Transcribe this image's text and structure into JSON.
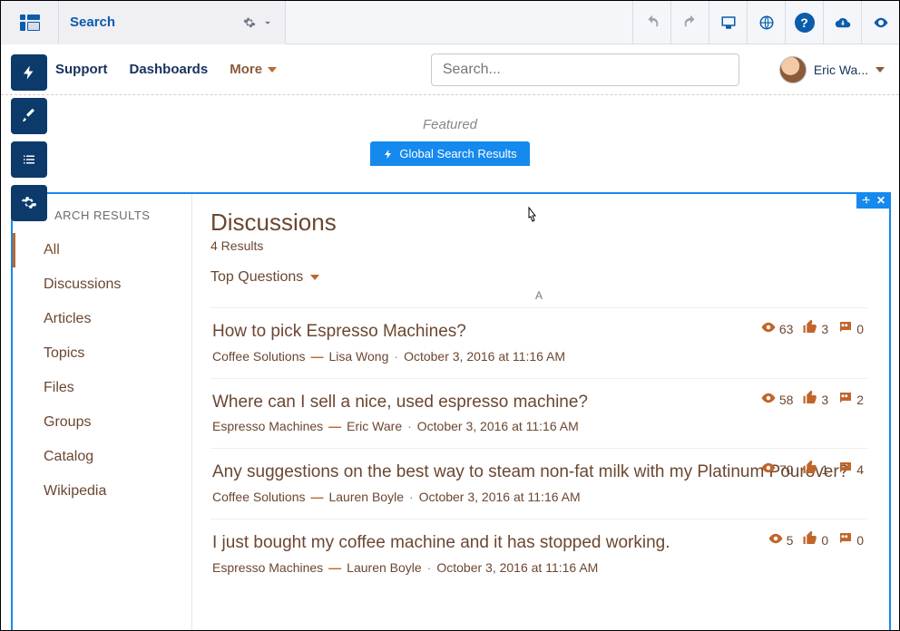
{
  "topbar": {
    "page_select": "Search"
  },
  "nav": {
    "items": [
      "Support",
      "Dashboards"
    ],
    "more": "More",
    "search_placeholder": "Search...",
    "user_name": "Eric Wa..."
  },
  "featured_label": "Featured",
  "pill_label": "Global Search Results",
  "sidebar": {
    "heading": "ARCH RESULTS",
    "items": [
      "All",
      "Discussions",
      "Articles",
      "Topics",
      "Files",
      "Groups",
      "Catalog",
      "Wikipedia"
    ],
    "active_index": 0
  },
  "main": {
    "title": "Discussions",
    "count_text": "4 Results",
    "sort_label": "Top Questions",
    "letter_heading": "A",
    "results": [
      {
        "title": "How to pick Espresso Machines?",
        "community": "Coffee Solutions",
        "author": "Lisa Wong",
        "date": "October 3, 2016 at 11:16 AM",
        "views": 63,
        "likes": 3,
        "comments": 0
      },
      {
        "title": "Where can I sell a nice, used espresso machine?",
        "community": "Espresso Machines",
        "author": "Eric Ware",
        "date": "October 3, 2016 at 11:16 AM",
        "views": 58,
        "likes": 3,
        "comments": 2
      },
      {
        "title": "Any suggestions on the best way to steam non-fat milk with my Platinum Pourover?",
        "community": "Coffee Solutions",
        "author": "Lauren Boyle",
        "date": "October 3, 2016 at 11:16 AM",
        "views": 70,
        "likes": 1,
        "comments": 4
      },
      {
        "title": "I just bought my coffee machine and it has stopped working.",
        "community": "Espresso Machines",
        "author": "Lauren Boyle",
        "date": "October 3, 2016 at 11:16 AM",
        "views": 5,
        "likes": 0,
        "comments": 0
      }
    ]
  },
  "handle": {
    "close": "✕"
  }
}
